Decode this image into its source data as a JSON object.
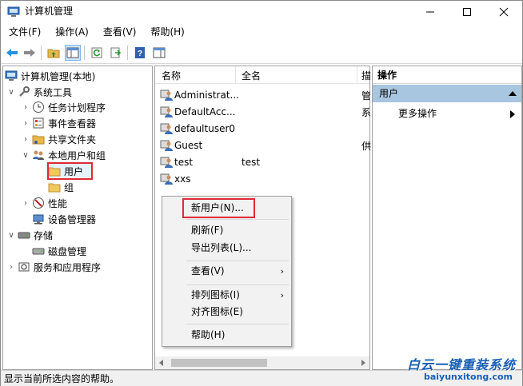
{
  "window": {
    "title": "计算机管理"
  },
  "menubar": {
    "items": [
      "文件(F)",
      "操作(A)",
      "查看(V)",
      "帮助(H)"
    ]
  },
  "tree": {
    "root": "计算机管理(本地)",
    "system_tools": "系统工具",
    "task_scheduler": "任务计划程序",
    "event_viewer": "事件查看器",
    "shared_folders": "共享文件夹",
    "local_users_groups": "本地用户和组",
    "users": "用户",
    "groups": "组",
    "performance": "性能",
    "device_manager": "设备管理器",
    "storage": "存储",
    "disk_management": "磁盘管理",
    "services_apps": "服务和应用程序"
  },
  "list": {
    "columns": [
      "名称",
      "全名",
      "描"
    ],
    "rows": [
      {
        "name": "Administrat...",
        "fullname": "",
        "desc": "管"
      },
      {
        "name": "DefaultAcc...",
        "fullname": "",
        "desc": "系"
      },
      {
        "name": "defaultuser0",
        "fullname": "",
        "desc": ""
      },
      {
        "name": "Guest",
        "fullname": "",
        "desc": "供"
      },
      {
        "name": "test",
        "fullname": "test",
        "desc": ""
      },
      {
        "name": "xxs",
        "fullname": "",
        "desc": ""
      }
    ]
  },
  "actions": {
    "header": "操作",
    "section": "用户",
    "more": "更多操作"
  },
  "context_menu": {
    "new_user": "新用户(N)...",
    "refresh": "刷新(F)",
    "export_list": "导出列表(L)...",
    "view": "查看(V)",
    "arrange_icons": "排列图标(I)",
    "align_icons": "对齐图标(E)",
    "help": "帮助(H)"
  },
  "statusbar": {
    "text": "显示当前所选内容的帮助。"
  },
  "watermark": {
    "cn": "白云一键重装系统",
    "url": "baiyunxitong.com"
  },
  "colors": {
    "highlight_box": "#e02a36",
    "action_section_bg": "#a9c6e1",
    "watermark": "#1a5fb4"
  }
}
